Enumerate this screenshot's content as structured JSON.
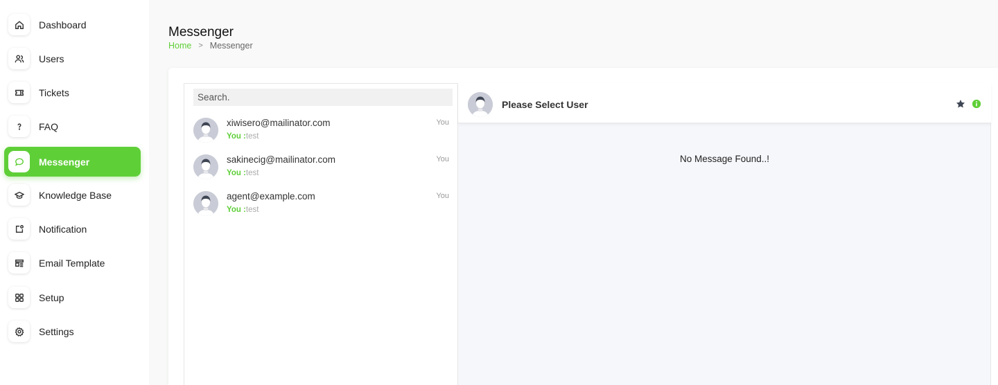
{
  "sidebar": {
    "items": [
      {
        "label": "Dashboard",
        "icon": "home-icon"
      },
      {
        "label": "Users",
        "icon": "users-icon"
      },
      {
        "label": "Tickets",
        "icon": "ticket-icon"
      },
      {
        "label": "FAQ",
        "icon": "question-icon"
      },
      {
        "label": "Messenger",
        "icon": "chat-icon",
        "active": true
      },
      {
        "label": "Knowledge Base",
        "icon": "graduation-cap-icon"
      },
      {
        "label": "Notification",
        "icon": "notification-icon"
      },
      {
        "label": "Email Template",
        "icon": "template-icon"
      },
      {
        "label": "Setup",
        "icon": "grid-icon"
      },
      {
        "label": "Settings",
        "icon": "gear-icon"
      }
    ]
  },
  "header": {
    "title": "Messenger",
    "breadcrumb": {
      "home": "Home",
      "separator": ">",
      "current": "Messenger"
    }
  },
  "messenger": {
    "search": {
      "placeholder": "Search."
    },
    "contacts": [
      {
        "email": "xiwisero@mailinator.com",
        "prefix": "You :",
        "message": "test",
        "time": "You"
      },
      {
        "email": "sakinecig@mailinator.com",
        "prefix": "You :",
        "message": "test",
        "time": "You"
      },
      {
        "email": "agent@example.com",
        "prefix": "You :",
        "message": "test",
        "time": "You"
      }
    ],
    "chat": {
      "title": "Please Select User",
      "empty_text": "No Message Found..!"
    }
  },
  "colors": {
    "accent": "#5fcf38",
    "star": "#3f4654",
    "info": "#5fcf38"
  }
}
